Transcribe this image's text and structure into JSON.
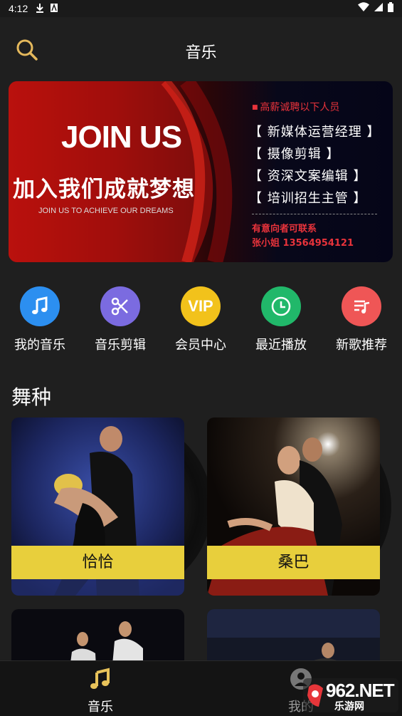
{
  "status_bar": {
    "time": "4:12"
  },
  "header": {
    "title": "音乐"
  },
  "banner": {
    "title": "JOIN US",
    "slogan": "加入我们成就梦想",
    "sub": "JOIN US TO ACHIEVE OUR DREAMS",
    "hiring": "高薪诚聘以下人员",
    "jobs": [
      "【 新媒体运营经理 】",
      "【  摄像剪辑  】",
      "【 资深文案编辑 】",
      "【 培训招生主管 】"
    ],
    "contact": [
      "有意向者可联系",
      "张小姐 13564954121"
    ]
  },
  "quick_entries": [
    {
      "label": "我的音乐",
      "icon": "music-note-icon",
      "color": "#2c8ff0"
    },
    {
      "label": "音乐剪辑",
      "icon": "scissors-icon",
      "color": "#7b6be0"
    },
    {
      "label": "会员中心",
      "icon": "vip-icon",
      "color": "#f2c21b",
      "icon_text": "VIP"
    },
    {
      "label": "最近播放",
      "icon": "clock-icon",
      "color": "#21b86a"
    },
    {
      "label": "新歌推荐",
      "icon": "playlist-icon",
      "color": "#ef5656"
    }
  ],
  "section": {
    "title": "舞种"
  },
  "dance_cards": [
    {
      "label": "恰恰"
    },
    {
      "label": "桑巴"
    }
  ],
  "bottom_nav": [
    {
      "label": "音乐",
      "icon": "music-note-icon",
      "active": true
    },
    {
      "label": "我的",
      "icon": "user-icon",
      "active": false
    }
  ],
  "watermark": {
    "brand": "962.NET",
    "sub": "乐游网"
  }
}
